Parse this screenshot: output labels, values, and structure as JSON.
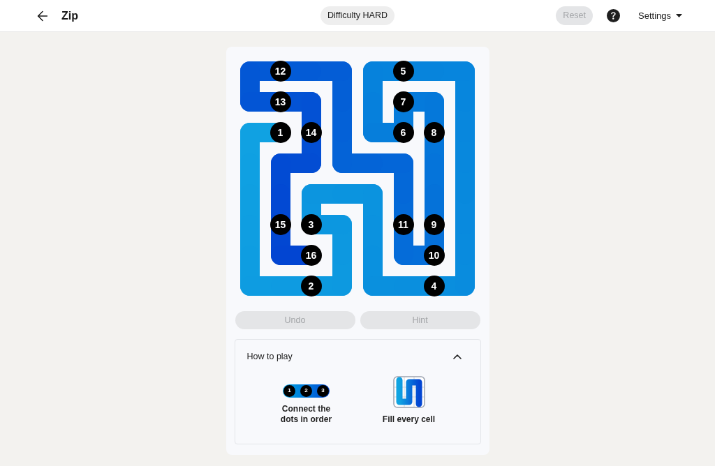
{
  "header": {
    "title": "Zip",
    "difficulty": "Difficulty HARD",
    "reset": {
      "label": "Reset",
      "disabled": true
    },
    "settings": {
      "label": "Settings"
    }
  },
  "board": {
    "dots": [
      {
        "label": "12"
      },
      {
        "label": "5"
      },
      {
        "label": "13"
      },
      {
        "label": "7"
      },
      {
        "label": "1"
      },
      {
        "label": "14"
      },
      {
        "label": "6"
      },
      {
        "label": "8"
      },
      {
        "label": "15"
      },
      {
        "label": "3"
      },
      {
        "label": "11"
      },
      {
        "label": "9"
      },
      {
        "label": "16"
      },
      {
        "label": "10"
      },
      {
        "label": "2"
      },
      {
        "label": "4"
      }
    ]
  },
  "actions": [
    {
      "label": "Undo",
      "disabled": true
    },
    {
      "label": "Hint",
      "disabled": true
    }
  ],
  "how_to_play": {
    "title": "How to play",
    "expanded": true,
    "tips": [
      {
        "kind": "dots",
        "caption": "Connect the dots in order",
        "icon_labels": [
          "1",
          "2",
          "3"
        ]
      },
      {
        "kind": "fill",
        "caption": "Fill every cell"
      }
    ]
  }
}
